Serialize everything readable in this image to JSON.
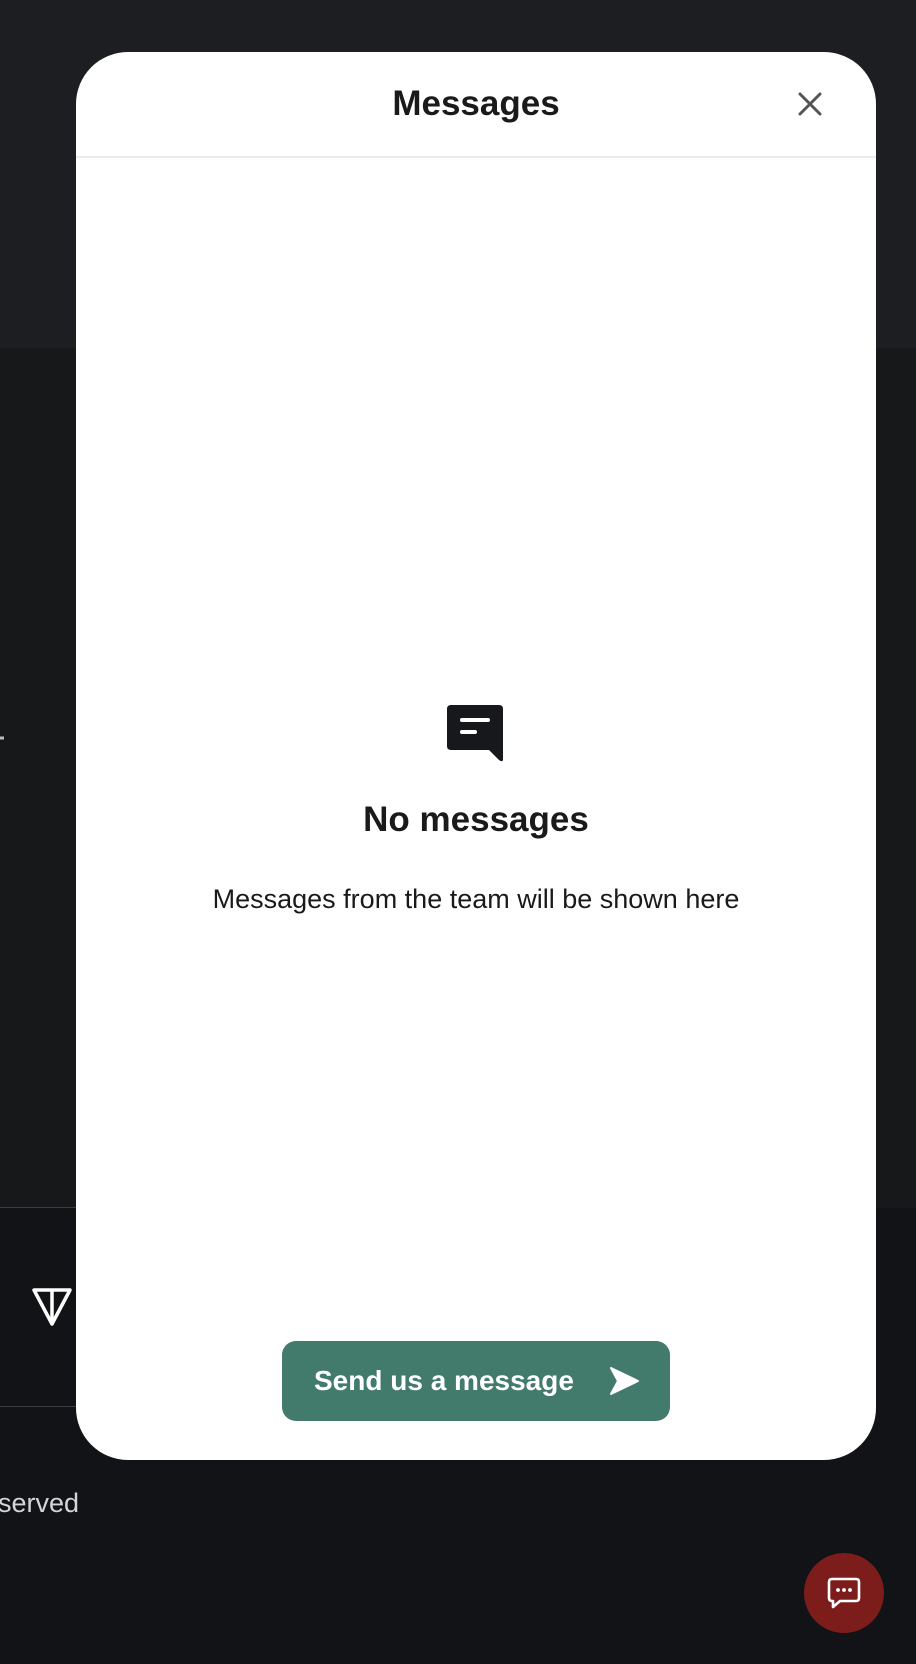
{
  "background": {
    "partial_glyph": "ปู",
    "rights_text": "served"
  },
  "modal": {
    "title": "Messages",
    "close_icon": "close-icon",
    "empty_state": {
      "icon": "chat-bubble-icon",
      "title": "No messages",
      "subtitle": "Messages from the team will be shown here"
    },
    "send_button": {
      "label": "Send us a message",
      "icon": "send-arrow-icon",
      "color": "#427a6b"
    }
  },
  "launcher": {
    "icon": "chat-icon",
    "color": "#7d1d1b"
  }
}
